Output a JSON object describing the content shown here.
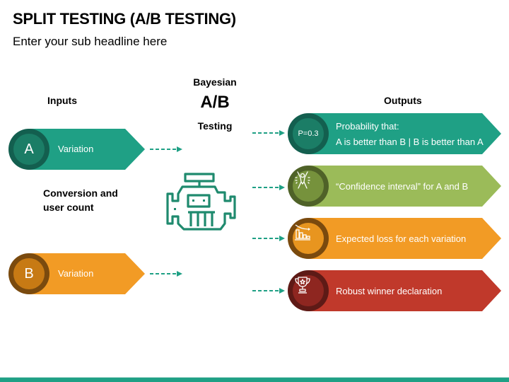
{
  "header": {
    "title": "SPLIT TESTING (A/B TESTING)",
    "subtitle": "Enter your sub headline here"
  },
  "columns": {
    "inputs_label": "Inputs",
    "outputs_label": "Outputs",
    "center_top": "Bayesian",
    "center_main": "A/B",
    "center_bottom": "Testing",
    "middle_note": "Conversion and user count"
  },
  "inputs": [
    {
      "badge": "A",
      "label": "Variation",
      "color": "#1fa085",
      "badge_ring": "#135f4f",
      "badge_fill": "#1b7d66"
    },
    {
      "badge": "B",
      "label": "Variation",
      "color": "#f29b25",
      "badge_ring": "#7a4a0e",
      "badge_fill": "#c77a14"
    }
  ],
  "engine": {
    "icon": "engine-icon",
    "color": "#1f8a6e"
  },
  "outputs": [
    {
      "badge": "P=0.3",
      "icon": null,
      "line1": "Probability that:",
      "line2": "A is better than B | B is better than A",
      "color": "#1fa085",
      "badge_ring": "#135f4f",
      "badge_fill": "#1b7d66"
    },
    {
      "badge": null,
      "icon": "celebrating-person-icon",
      "line1": "“Confidence interval” for A and B",
      "line2": null,
      "color": "#9bbb59",
      "badge_ring": "#4f6228",
      "badge_fill": "#76923c"
    },
    {
      "badge": null,
      "icon": "declining-bar-chart-icon",
      "line1": "Expected loss for each variation",
      "line2": null,
      "color": "#f29b25",
      "badge_ring": "#7a4a0e",
      "badge_fill": "#e8951f"
    },
    {
      "badge": null,
      "icon": "trophy-icon",
      "line1": "Robust winner declaration",
      "line2": null,
      "color": "#c0392b",
      "badge_ring": "#5e1a16",
      "badge_fill": "#8e2620"
    }
  ],
  "arrow_color": "#1fa085",
  "footer_bar_color": "#1fa085"
}
